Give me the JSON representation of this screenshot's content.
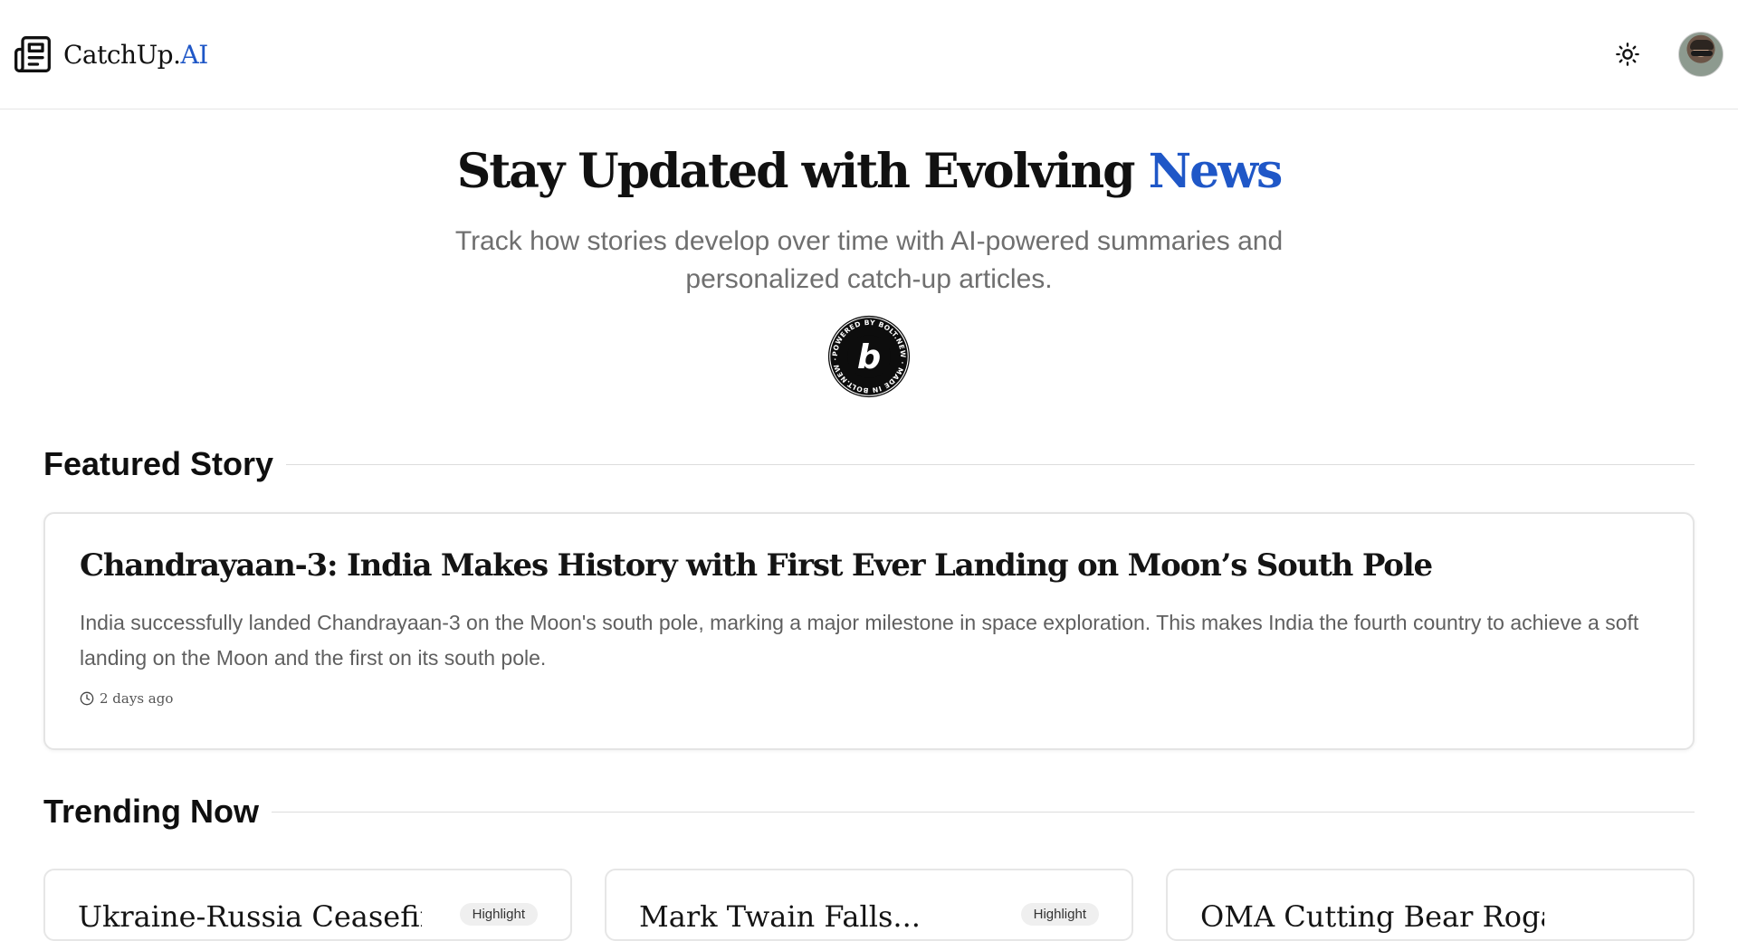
{
  "header": {
    "brand_main": "CatchUp.",
    "brand_ai": "AI",
    "theme_toggle_icon": "sun-icon",
    "avatar_icon": "user-avatar"
  },
  "hero": {
    "title_main": "Stay Updated with ",
    "title_accent_mid": "Evolving",
    "title_accent": " News",
    "subtitle": "Track how stories develop over time with AI-powered summaries and personalized catch-up articles.",
    "badge_text": "POWERED BY BOLT.NEW · MADE IN BOLT.NEW ·",
    "badge_letter": "b"
  },
  "featured": {
    "heading": "Featured Story",
    "title": "Chandrayaan-3: India Makes History with First Ever Landing on Moon’s South Pole",
    "summary": "India successfully landed Chandrayaan-3 on the Moon's south pole, marking a major milestone in space exploration. This makes India the fourth country to achieve a soft landing on the Moon and the first on its south pole.",
    "time": "2 days ago"
  },
  "trending": {
    "heading": "Trending Now",
    "cards": [
      {
        "title": "Ukraine-Russia Ceasefire...",
        "pill": "Highlight"
      },
      {
        "title": "Mark Twain Falls...",
        "pill": "Highlight"
      },
      {
        "title": "OMA Cutting Bear Rogaine Rap...",
        "pill": ""
      }
    ]
  },
  "colors": {
    "accent": "#1f57c7",
    "text": "#111111",
    "muted": "#6f6f6f",
    "border": "#e4e4e4"
  }
}
